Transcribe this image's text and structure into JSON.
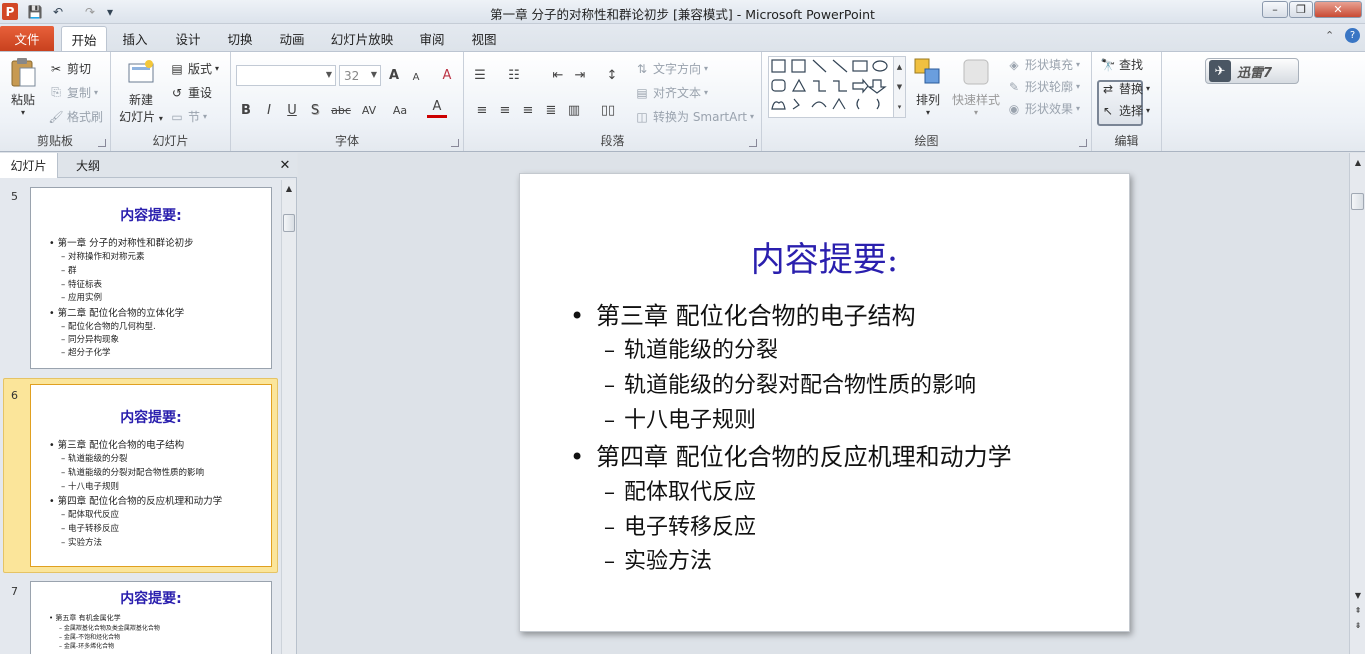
{
  "window": {
    "title": "第一章  分子的对称性和群论初步 [兼容模式] - Microsoft PowerPoint",
    "minimize": "–",
    "restore": "❐",
    "close": "✕"
  },
  "qat": {
    "app_icon": "P",
    "save": "💾",
    "undo": "↶",
    "redo": "↷",
    "more": "▾"
  },
  "tabs": [
    {
      "label": "文件"
    },
    {
      "label": "开始"
    },
    {
      "label": "插入"
    },
    {
      "label": "设计"
    },
    {
      "label": "切换"
    },
    {
      "label": "动画"
    },
    {
      "label": "幻灯片放映"
    },
    {
      "label": "审阅"
    },
    {
      "label": "视图"
    }
  ],
  "ribbon": {
    "clipboard": {
      "label": "剪贴板",
      "paste": "粘贴",
      "cut": "剪切",
      "copy": "复制",
      "format_painter": "格式刷"
    },
    "slides": {
      "label": "幻灯片",
      "new_slide_1": "新建",
      "new_slide_2": "幻灯片",
      "layout": "版式",
      "reset": "重设",
      "section": "节"
    },
    "font": {
      "label": "字体",
      "font_name": "",
      "font_size": "32",
      "bold": "B",
      "italic": "I",
      "underline": "U",
      "shadow": "S",
      "strike": "abc",
      "spacing": "AV",
      "case": "Aa",
      "grow": "A",
      "shrink": "A",
      "clear": "A",
      "color": "A"
    },
    "paragraph": {
      "label": "段落",
      "text_direction": "文字方向",
      "align_text": "对齐文本",
      "smartart": "转换为 SmartArt"
    },
    "drawing": {
      "label": "绘图",
      "arrange": "排列",
      "quick_styles": "快速样式",
      "shape_fill": "形状填充",
      "shape_outline": "形状轮廓",
      "shape_effects": "形状效果"
    },
    "editing": {
      "label": "编辑",
      "find": "查找",
      "replace": "替换",
      "select": "选择"
    },
    "xunlei": "迅雷7"
  },
  "panel": {
    "tab_slides": "幻灯片",
    "tab_outline": "大纲",
    "close": "✕",
    "slides": [
      {
        "num": "5",
        "title": "内容提要:",
        "lines": [
          {
            "lvl": 1,
            "text": "第一章  分子的对称性和群论初步"
          },
          {
            "lvl": 2,
            "text": "对称操作和对称元素"
          },
          {
            "lvl": 2,
            "text": "群"
          },
          {
            "lvl": 2,
            "text": "特征标表"
          },
          {
            "lvl": 2,
            "text": "应用实例"
          },
          {
            "lvl": 1,
            "text": "第二章  配位化合物的立体化学"
          },
          {
            "lvl": 2,
            "text": "配位化合物的几何构型."
          },
          {
            "lvl": 2,
            "text": "同分异构现象"
          },
          {
            "lvl": 2,
            "text": "超分子化学"
          }
        ]
      },
      {
        "num": "6",
        "title": "内容提要:",
        "lines": [
          {
            "lvl": 1,
            "text": "第三章  配位化合物的电子结构"
          },
          {
            "lvl": 2,
            "text": "轨道能级的分裂"
          },
          {
            "lvl": 2,
            "text": "轨道能级的分裂对配合物性质的影响"
          },
          {
            "lvl": 2,
            "text": "十八电子规则"
          },
          {
            "lvl": 1,
            "text": "第四章 配位化合物的反应机理和动力学"
          },
          {
            "lvl": 2,
            "text": "配体取代反应"
          },
          {
            "lvl": 2,
            "text": "电子转移反应"
          },
          {
            "lvl": 2,
            "text": "实验方法"
          }
        ]
      },
      {
        "num": "7",
        "title": "内容提要:",
        "lines": [
          {
            "lvl": 1,
            "text": "第五章  有机金属化学"
          },
          {
            "lvl": 2,
            "text": "金属羰基化合物及类金属羰基化合物"
          },
          {
            "lvl": 2,
            "text": "金属-不饱和烃化合物"
          },
          {
            "lvl": 2,
            "text": "金属-环多烯化合物"
          }
        ]
      }
    ]
  },
  "slide": {
    "title": "内容提要:",
    "bullet_char": "•",
    "dash_char": "–",
    "lines": [
      {
        "lvl": 1,
        "text": "第三章  配位化合物的电子结构"
      },
      {
        "lvl": 2,
        "text": "轨道能级的分裂"
      },
      {
        "lvl": 2,
        "text": "轨道能级的分裂对配合物性质的影响"
      },
      {
        "lvl": 2,
        "text": "十八电子规则"
      },
      {
        "lvl": 1,
        "text": "第四章 配位化合物的反应机理和动力学"
      },
      {
        "lvl": 2,
        "text": "配体取代反应"
      },
      {
        "lvl": 2,
        "text": "电子转移反应"
      },
      {
        "lvl": 2,
        "text": "实验方法"
      }
    ]
  },
  "colors": {
    "accent_file": "#d9532d",
    "slide_title": "#2a1fae",
    "selected_slide": "#fbe59a"
  },
  "icons": [
    "app-icon",
    "save-icon",
    "undo-icon",
    "redo-icon",
    "paste-icon",
    "cut-icon",
    "copy-icon",
    "format-painter-icon",
    "new-slide-icon",
    "layout-icon",
    "reset-icon",
    "section-icon",
    "arrange-icon",
    "quick-styles-icon",
    "shape-fill-icon",
    "shape-outline-icon",
    "shape-effects-icon",
    "find-icon",
    "replace-icon",
    "select-icon",
    "xunlei-icon",
    "help-icon",
    "ribbon-minimize-icon"
  ]
}
